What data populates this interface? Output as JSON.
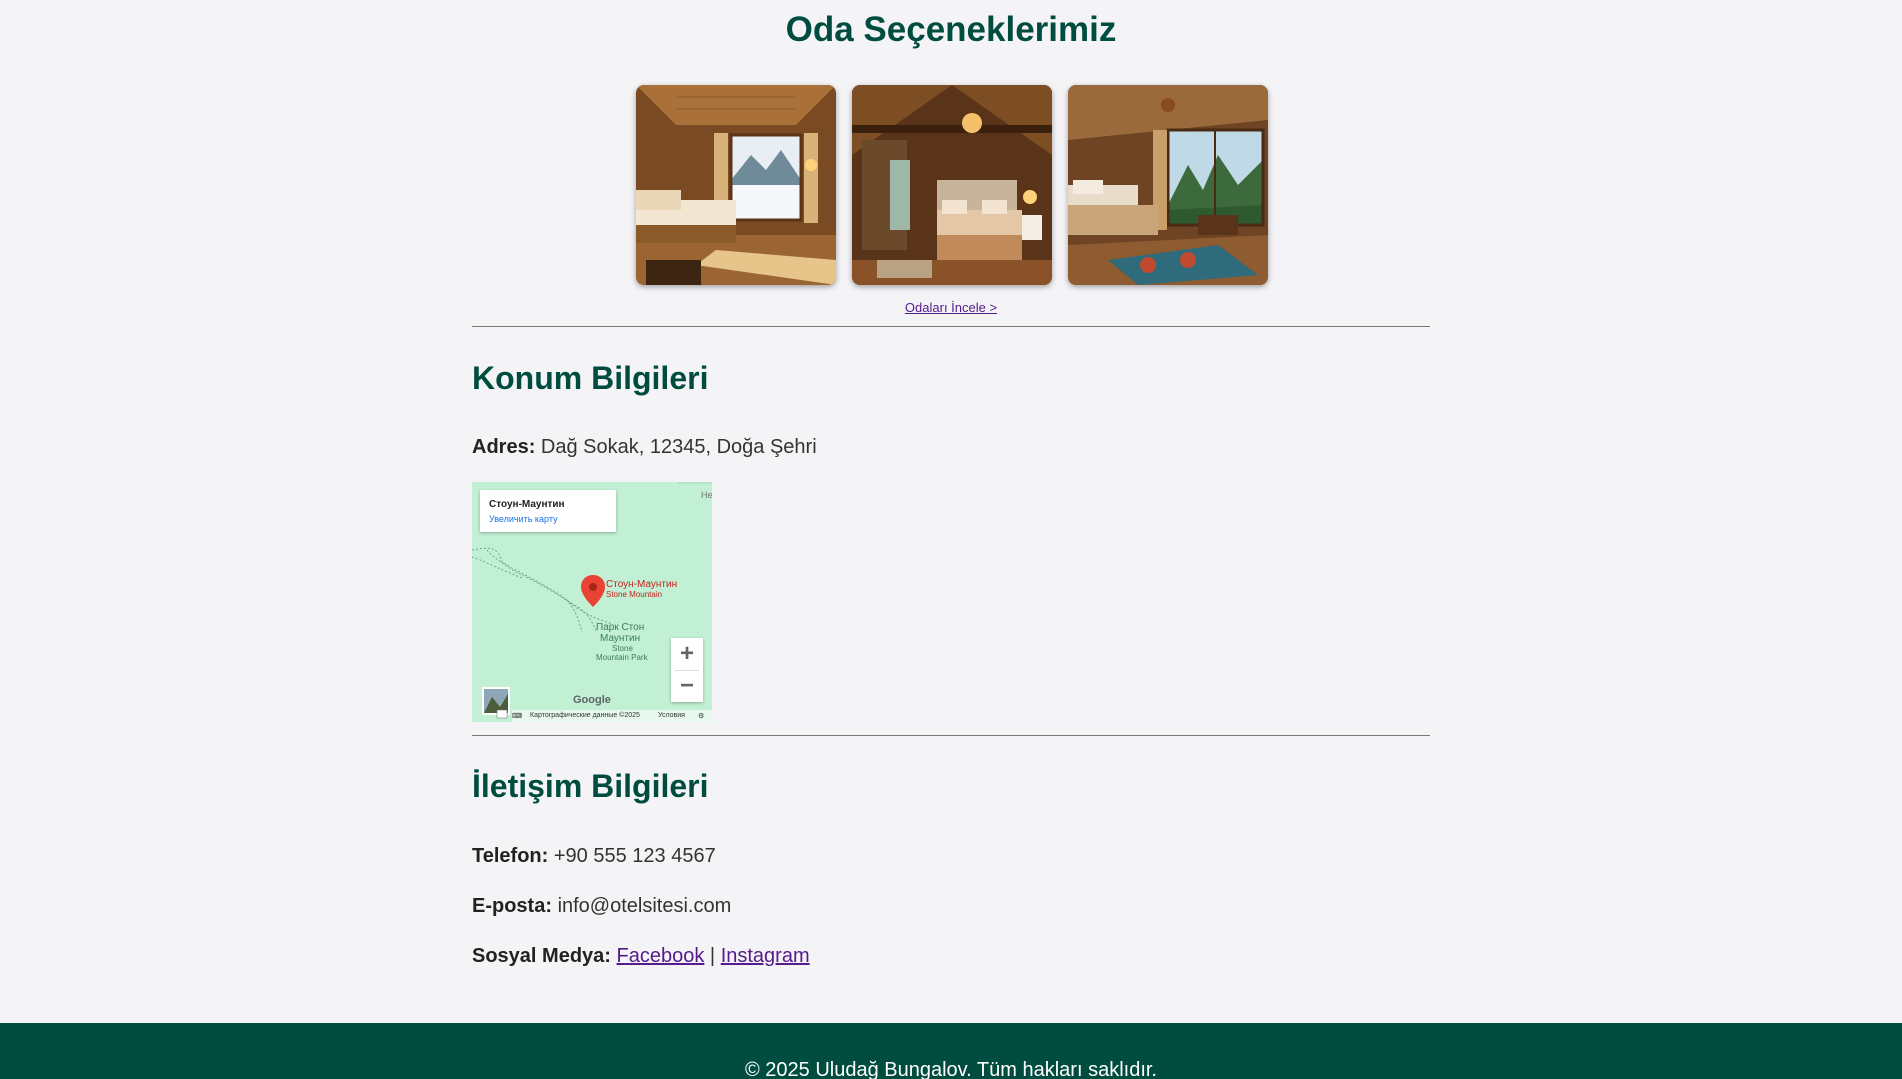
{
  "rooms": {
    "title": "Oda Seçeneklerimiz",
    "images": [
      "room-photo-1",
      "room-photo-2",
      "room-photo-3"
    ],
    "link_label": "Odaları İncele >"
  },
  "location": {
    "title": "Konum Bilgileri",
    "address_label": "Adres:",
    "address_value": "Dağ Sokak, 12345, Doğa Şehri",
    "map": {
      "place_name": "Стоун-Маунтин",
      "enlarge_label": "Увеличить карту",
      "marker_label": "Стоун-Маунтин",
      "marker_sublabel": "Stone Mountain",
      "park_label_1": "Парк Стон",
      "park_label_2": "Маунтин",
      "park_label_3": "Stone",
      "park_label_4": "Mountain Park",
      "edge_label": "Не",
      "zoom_in": "+",
      "zoom_out": "−",
      "logo": "Google",
      "map_data": "Картографические данные ©2025",
      "terms": "Условия"
    }
  },
  "contact": {
    "title": "İletişim Bilgileri",
    "phone_label": "Telefon:",
    "phone_value": "+90 555 123 4567",
    "email_label": "E-posta:",
    "email_value": "info@otelsitesi.com",
    "social_label": "Sosyal Medya:",
    "facebook": "Facebook",
    "separator": "|",
    "instagram": "Instagram"
  },
  "footer": {
    "copyright": "© 2025 Uludağ Bungalov. Tüm hakları saklıdır."
  },
  "colors": {
    "heading": "#004d40",
    "footer_bg": "#004d40",
    "link": "#551a8b",
    "page_bg": "#f4f4f7"
  }
}
